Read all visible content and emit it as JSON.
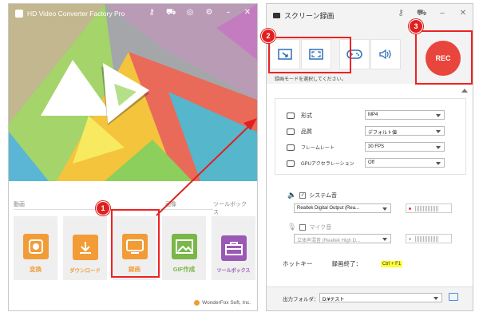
{
  "left_window": {
    "title": "HD Video Converter Factory Pro",
    "controls": [
      "key-icon",
      "cart-icon",
      "globe-icon",
      "gear-icon",
      "minimize-icon",
      "close-icon"
    ],
    "sections": {
      "video": "動画",
      "image": "画像",
      "toolbox": "ツールボックス"
    },
    "tiles": [
      {
        "label": "変換",
        "color": "#f29c38",
        "icon": "film-icon"
      },
      {
        "label": "ダウンロード",
        "color": "#f29c38",
        "icon": "download-icon"
      },
      {
        "label": "録画",
        "color": "#f29c38",
        "icon": "screen-record-icon"
      },
      {
        "label": "GIF作成",
        "color": "#7ab648",
        "icon": "image-icon"
      },
      {
        "label": "ツールボックス",
        "color": "#9b59b6",
        "icon": "toolbox-icon"
      }
    ],
    "footer": "WonderFox Soft, Inc."
  },
  "right_window": {
    "title": "スクリーン録画",
    "modes": [
      "region-capture-icon",
      "fullscreen-capture-icon",
      "gamepad-icon",
      "audio-icon"
    ],
    "rec_label": "REC",
    "hint": "録画モードを選択してください。",
    "settings": [
      {
        "label": "形式",
        "value": "MP4",
        "icon": "format-icon"
      },
      {
        "label": "品質",
        "value": "デフォルト値",
        "icon": "quality-icon"
      },
      {
        "label": "フレームレート",
        "value": "30 FPS",
        "icon": "framerate-icon"
      },
      {
        "label": "GPUアクセラレーション",
        "value": "Off",
        "icon": "gpu-icon"
      }
    ],
    "system_audio": {
      "label": "システム音",
      "checked": true,
      "device": "Realtek Digital Output (Rea..."
    },
    "mic": {
      "label": "マイク音",
      "checked": false,
      "device": "立体声混音 (Realtek High D..."
    },
    "hotkey": {
      "label": "ホットキー",
      "action": "録画終了：",
      "key": "Ctrl + F1"
    },
    "output": {
      "label": "出力フォルダ：",
      "path": "D:¥テスト"
    }
  },
  "annotations": {
    "badge1": "1",
    "badge2": "2",
    "badge3": "3",
    "highlight_color": "#e02020"
  }
}
